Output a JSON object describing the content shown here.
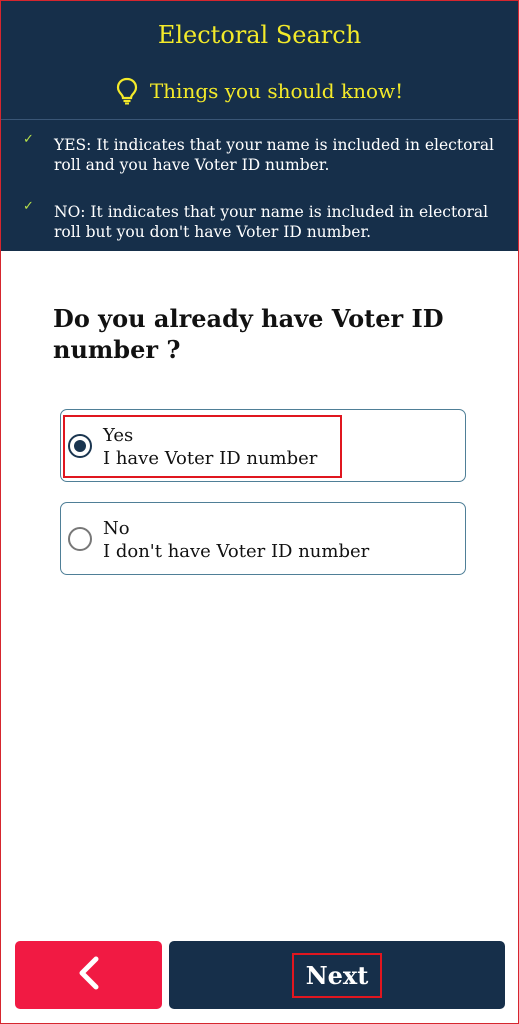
{
  "header": {
    "title": "Electoral Search",
    "tip_icon": "lightbulb-icon",
    "tip_title": "Things you should know!",
    "notes": [
      {
        "icon": "checkmark-icon",
        "text": "YES: It indicates that your name is included in electoral roll and you have Voter ID number."
      },
      {
        "icon": "checkmark-icon",
        "text": "NO: It indicates that your name is included in electoral roll but you don't have Voter ID number."
      }
    ]
  },
  "question": "Do you already have Voter ID number ?",
  "options": [
    {
      "label": "Yes",
      "sub": "I have Voter ID number",
      "selected": true
    },
    {
      "label": "No",
      "sub": "I don't have Voter ID number",
      "selected": false
    }
  ],
  "footer": {
    "back_icon": "chevron-left-icon",
    "next_label": "Next"
  },
  "colors": {
    "header_bg": "#162f4a",
    "title": "#f3ea2a",
    "back_button": "#f11a43",
    "next_button": "#162f4a",
    "highlight": "#e0161f"
  }
}
